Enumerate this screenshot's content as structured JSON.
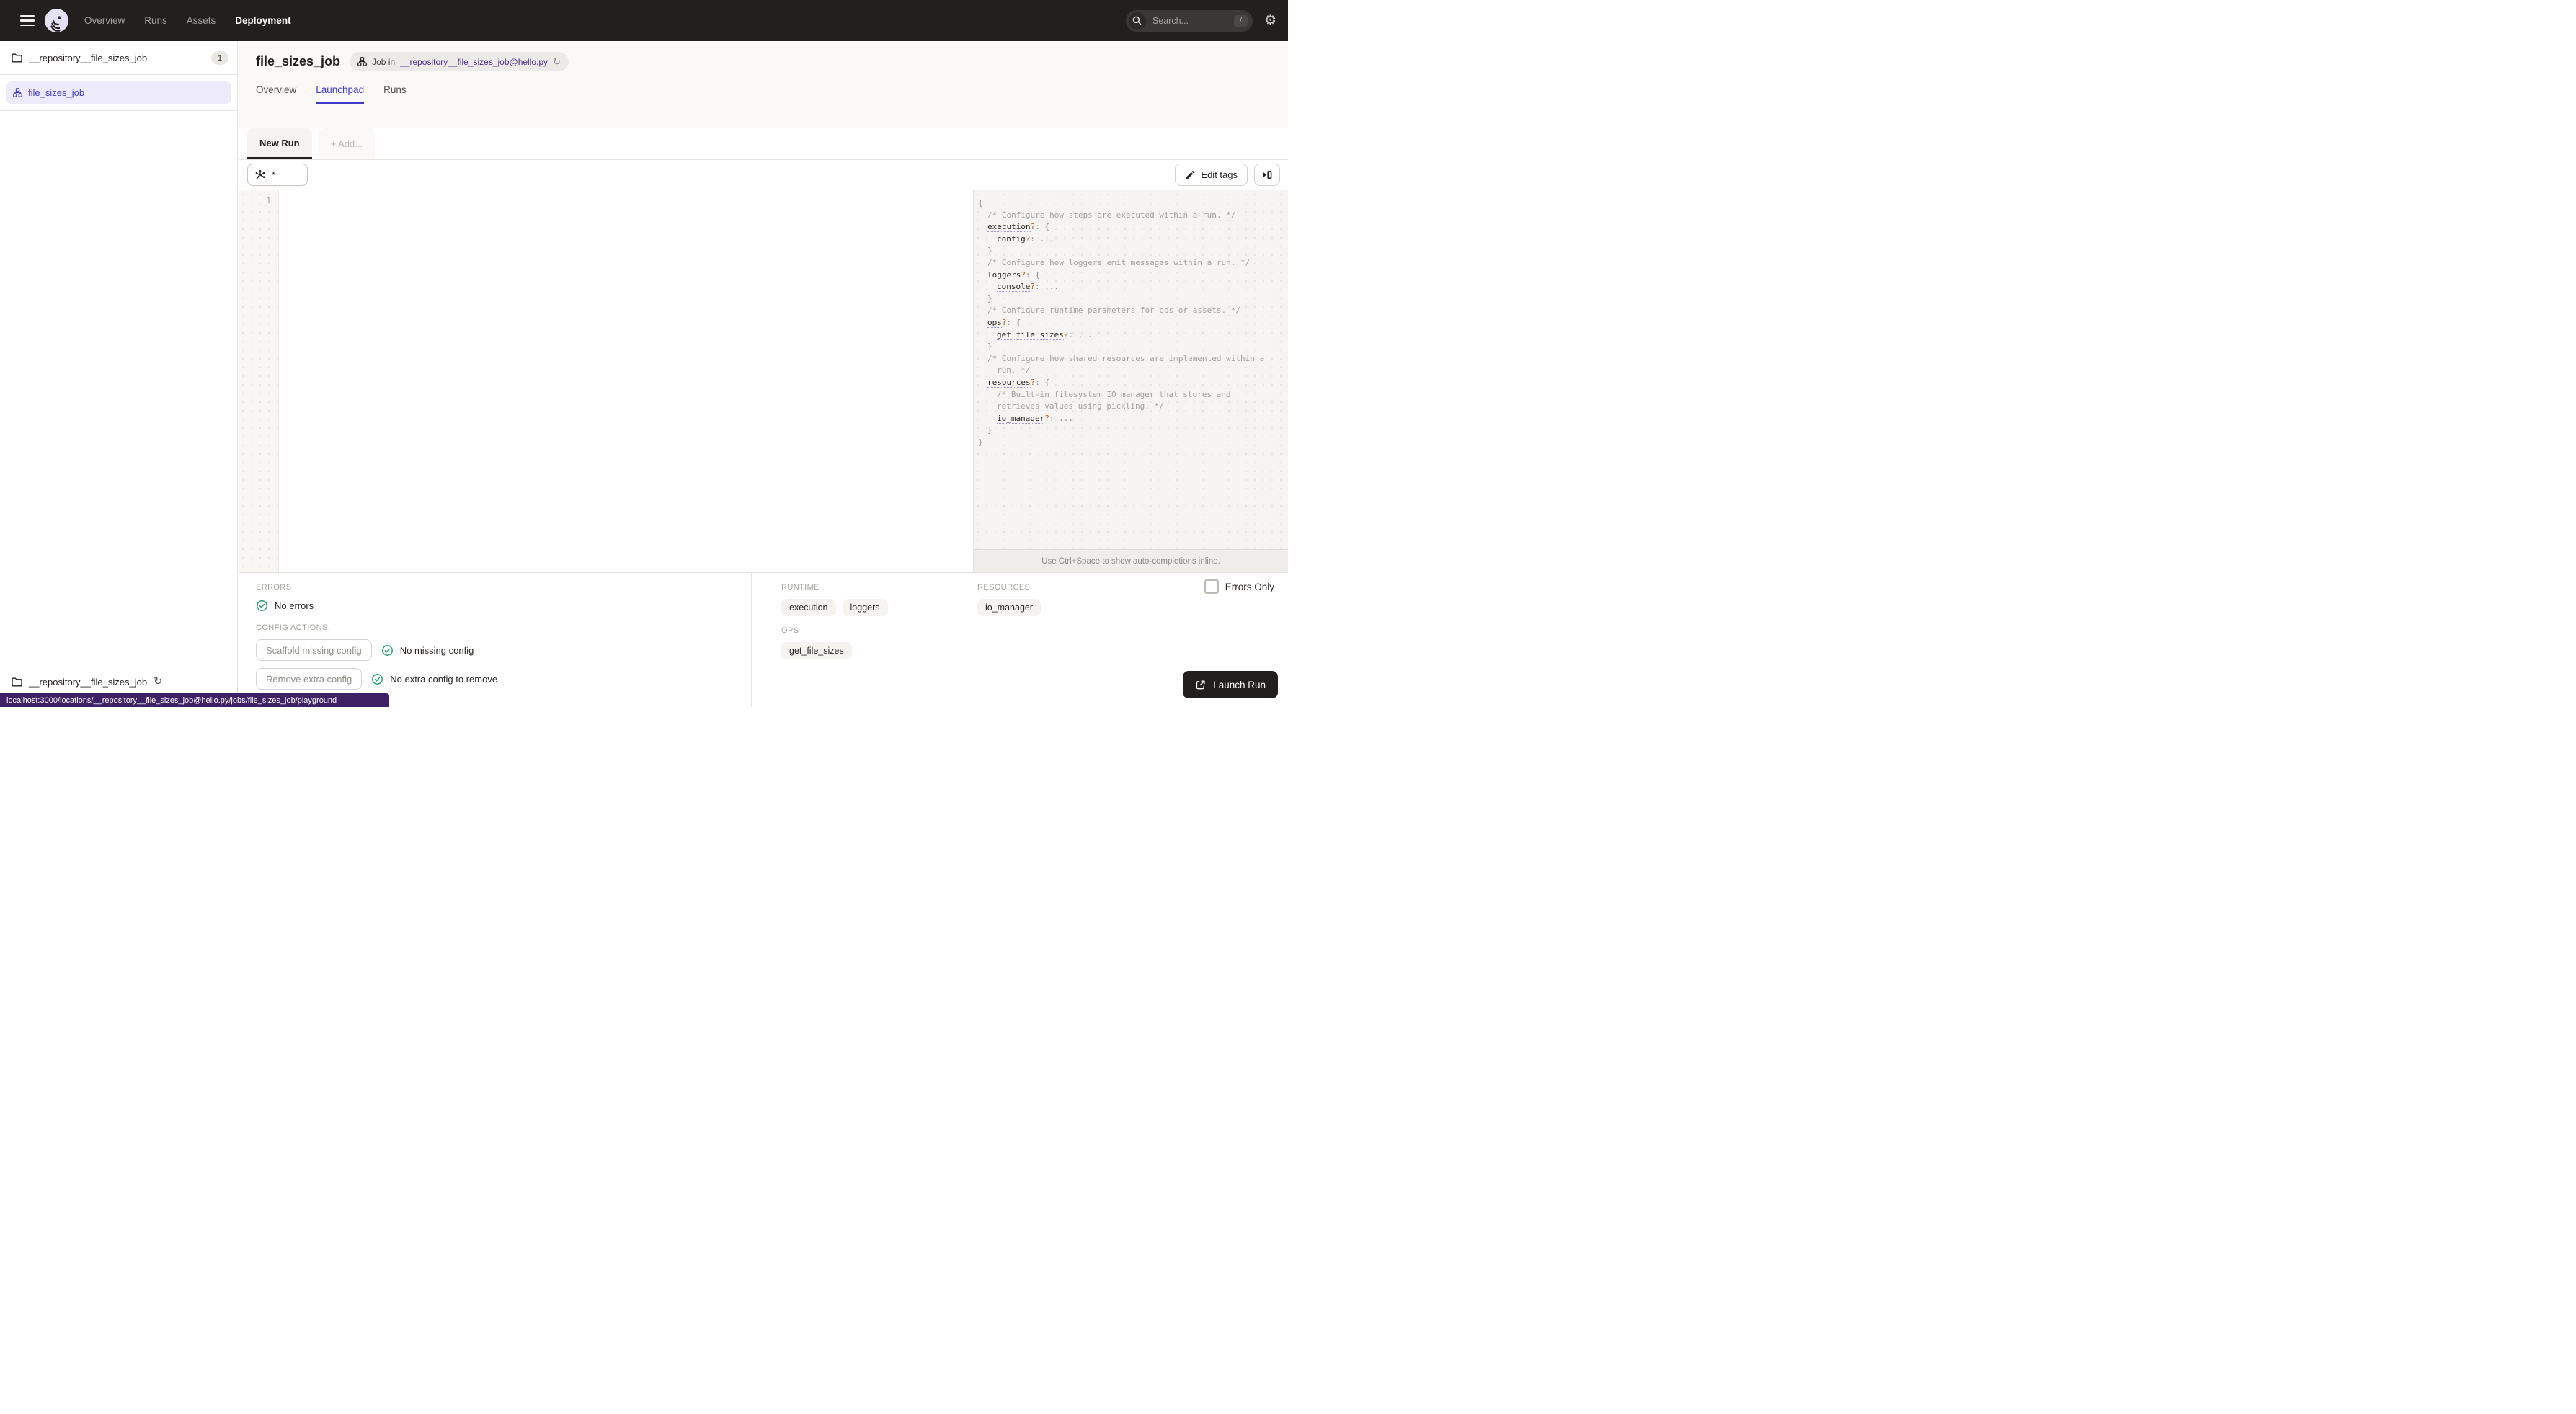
{
  "nav": {
    "items": [
      "Overview",
      "Runs",
      "Assets",
      "Deployment"
    ],
    "active": "Deployment",
    "search_placeholder": "Search...",
    "search_shortcut": "/"
  },
  "sidebar": {
    "repo_name": "__repository__file_sizes_job",
    "repo_count": "1",
    "job_name": "file_sizes_job",
    "footer_repo": "__repository__file_sizes_job"
  },
  "header": {
    "title": "file_sizes_job",
    "breadcrumb_prefix": "Job in",
    "breadcrumb_link": "__repository__file_sizes_job@hello.py",
    "tabs": [
      "Overview",
      "Launchpad",
      "Runs"
    ],
    "active_tab": "Launchpad"
  },
  "launchpad": {
    "run_tab": "New Run",
    "add_tab": "+ Add...",
    "op_selector_value": "*",
    "edit_tags_label": "Edit tags",
    "line_number": "1",
    "hint": "Use Ctrl+Space to show auto-completions inline."
  },
  "schema": {
    "lines": [
      {
        "i": 0,
        "t": [
          [
            "p",
            "{"
          ]
        ]
      },
      {
        "i": 1,
        "t": [
          [
            "c",
            "/* Configure how steps are executed within a run. */"
          ]
        ]
      },
      {
        "i": 1,
        "t": [
          [
            "k",
            "execution"
          ],
          [
            "q",
            "?"
          ],
          [
            "p",
            ": {"
          ]
        ]
      },
      {
        "i": 2,
        "t": [
          [
            "k",
            "config"
          ],
          [
            "q",
            "?"
          ],
          [
            "p",
            ": ..."
          ]
        ]
      },
      {
        "i": 1,
        "t": [
          [
            "p",
            "}"
          ]
        ]
      },
      {
        "i": 1,
        "t": [
          [
            "c",
            "/* Configure how loggers emit messages within a run. */"
          ]
        ]
      },
      {
        "i": 1,
        "t": [
          [
            "k",
            "loggers"
          ],
          [
            "q",
            "?"
          ],
          [
            "p",
            ": {"
          ]
        ]
      },
      {
        "i": 2,
        "t": [
          [
            "k",
            "console"
          ],
          [
            "q",
            "?"
          ],
          [
            "p",
            ": ..."
          ]
        ]
      },
      {
        "i": 1,
        "t": [
          [
            "p",
            "}"
          ]
        ]
      },
      {
        "i": 1,
        "t": [
          [
            "c",
            "/* Configure runtime parameters for ops or assets. */"
          ]
        ]
      },
      {
        "i": 1,
        "t": [
          [
            "k",
            "ops"
          ],
          [
            "q",
            "?"
          ],
          [
            "p",
            ": {"
          ]
        ]
      },
      {
        "i": 2,
        "t": [
          [
            "k",
            "get_file_sizes"
          ],
          [
            "q",
            "?"
          ],
          [
            "p",
            ": ..."
          ]
        ]
      },
      {
        "i": 1,
        "t": [
          [
            "p",
            "}"
          ]
        ]
      },
      {
        "i": 1,
        "t": [
          [
            "c",
            "/* Configure how shared resources are implemented within a"
          ]
        ]
      },
      {
        "i": 2,
        "t": [
          [
            "c",
            "run. */"
          ]
        ]
      },
      {
        "i": 1,
        "t": [
          [
            "k",
            "resources"
          ],
          [
            "q",
            "?"
          ],
          [
            "p",
            ": {"
          ]
        ]
      },
      {
        "i": 2,
        "t": [
          [
            "c",
            "/* Built-in filesystem IO manager that stores and"
          ]
        ]
      },
      {
        "i": 2,
        "t": [
          [
            "c",
            "retrieves values using pickling. */"
          ]
        ]
      },
      {
        "i": 2,
        "t": [
          [
            "k",
            "io_manager"
          ],
          [
            "q",
            "?"
          ],
          [
            "p",
            ": ..."
          ]
        ]
      },
      {
        "i": 1,
        "t": [
          [
            "p",
            "}"
          ]
        ]
      },
      {
        "i": 0,
        "t": [
          [
            "p",
            "}"
          ]
        ]
      }
    ]
  },
  "bottom": {
    "errors_label": "ERRORS",
    "no_errors": "No errors",
    "config_actions_label": "CONFIG ACTIONS:",
    "actions": [
      {
        "button": "Scaffold missing config",
        "status": "No missing config"
      },
      {
        "button": "Remove extra config",
        "status": "No extra config to remove"
      }
    ],
    "runtime_label": "RUNTIME",
    "runtime_tags": [
      "execution",
      "loggers"
    ],
    "resources_label": "RESOURCES",
    "resources_tags": [
      "io_manager"
    ],
    "ops_label": "OPS",
    "ops_tags": [
      "get_file_sizes"
    ],
    "errors_only_label": "Errors Only",
    "launch_label": "Launch Run"
  },
  "statusbar": {
    "url": "localhost:3000/locations/__repository__file_sizes_job@hello.py/jobs/file_sizes_job/playground"
  },
  "colors": {
    "navbar_bg": "#231F1E",
    "accent_purple": "#4542CC",
    "link_purple": "#4F2E8C",
    "active_tab_blue": "#3E3BC8",
    "success_green": "#23A36D",
    "statusbar_purple": "#3E2265"
  }
}
